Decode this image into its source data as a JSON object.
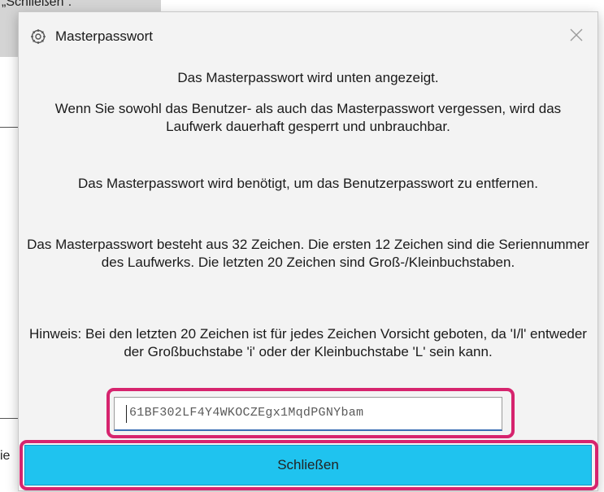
{
  "background": {
    "top_label": "„Schließen“.",
    "bottom_fragment": "ie"
  },
  "dialog": {
    "title": "Masterpasswort",
    "icon": "app-gear-icon",
    "close_icon": "close-icon",
    "paragraphs": [
      "Das Masterpasswort wird unten angezeigt.",
      "Wenn Sie sowohl das Benutzer- als auch das Masterpasswort vergessen, wird das Laufwerk dauerhaft gesperrt und unbrauchbar.",
      "Das Masterpasswort wird benötigt, um das Benutzerpasswort zu entfernen.",
      "Das Masterpasswort besteht aus 32 Zeichen. Die ersten 12 Zeichen sind die Seriennummer des Laufwerks. Die letzten 20 Zeichen sind Groß-/Kleinbuchstaben.",
      "Hinweis: Bei den letzten 20 Zeichen ist für jedes Zeichen Vorsicht geboten, da 'I/l' entweder der Großbuchstabe 'i' oder der Kleinbuchstabe 'L' sein kann."
    ],
    "password_value": "61BF302LF4Y4WKOCZEgx1MqdPGNYbam",
    "close_button_label": "Schließen"
  },
  "colors": {
    "button_bg": "#1fc3ef",
    "highlight": "#d6246e"
  }
}
